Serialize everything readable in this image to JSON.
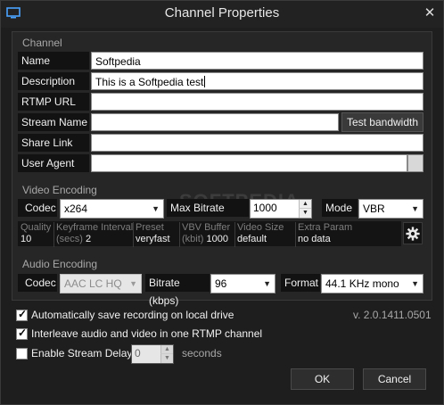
{
  "window": {
    "title": "Channel Properties",
    "close_glyph": "✕"
  },
  "channel": {
    "section_label": "Channel",
    "name": {
      "label": "Name",
      "value": "Softpedia"
    },
    "description": {
      "label": "Description",
      "value": "This is a Softpedia test"
    },
    "rtmp_url": {
      "label": "RTMP URL",
      "value": ""
    },
    "stream_name": {
      "label": "Stream Name",
      "value": ""
    },
    "test_bandwidth_label": "Test bandwidth",
    "share_link": {
      "label": "Share Link",
      "value": ""
    },
    "user_agent": {
      "label": "User Agent",
      "value": ""
    }
  },
  "video": {
    "section_label": "Video Encoding",
    "codec": {
      "label": "Codec",
      "value": "x264"
    },
    "max_bitrate": {
      "label": "Max Bitrate (kbps)",
      "value": "1000"
    },
    "mode": {
      "label": "Mode",
      "value": "VBR"
    },
    "info": [
      {
        "key": "Quality",
        "value": "10"
      },
      {
        "key": "Keyframe Interval (secs)",
        "key_line1": "Keyframe Interval",
        "key_line2": "(secs)",
        "value": "2"
      },
      {
        "key": "Preset",
        "value": "veryfast"
      },
      {
        "key": "VBV Buffer (kbit)",
        "key_line1": "VBV Buffer",
        "key_line2": "(kbit)",
        "value": "1000"
      },
      {
        "key": "Video Size",
        "value": "default"
      },
      {
        "key": "Extra Param",
        "value": "no data"
      }
    ]
  },
  "audio": {
    "section_label": "Audio Encoding",
    "codec": {
      "label": "Codec",
      "value": "AAC LC HQ"
    },
    "bitrate": {
      "label": "Bitrate (kbps)",
      "value": "96"
    },
    "format": {
      "label": "Format",
      "value": "44.1 KHz mono"
    }
  },
  "options": {
    "auto_save": {
      "label": "Automatically save recording on local drive",
      "checked": true
    },
    "interleave": {
      "label": "Interleave audio and video in one RTMP channel",
      "checked": true
    },
    "stream_delay": {
      "label": "Enable Stream Delay",
      "checked": false,
      "value": "0",
      "unit": "seconds"
    },
    "version": "v. 2.0.1411.0501"
  },
  "buttons": {
    "ok": "OK",
    "cancel": "Cancel"
  },
  "watermark": "SOFTPEDIA",
  "icons": {
    "app": "monitor-icon",
    "close": "close-icon",
    "settings": "gear-icon",
    "dropdown": "chevron-down-icon",
    "spin_up": "spin-up-icon",
    "spin_down": "spin-down-icon",
    "check": "checkmark-icon"
  },
  "colors": {
    "background": "#1e1e1e",
    "panel": "#262626",
    "label_bg": "#121212",
    "field_bg": "#ffffff"
  }
}
